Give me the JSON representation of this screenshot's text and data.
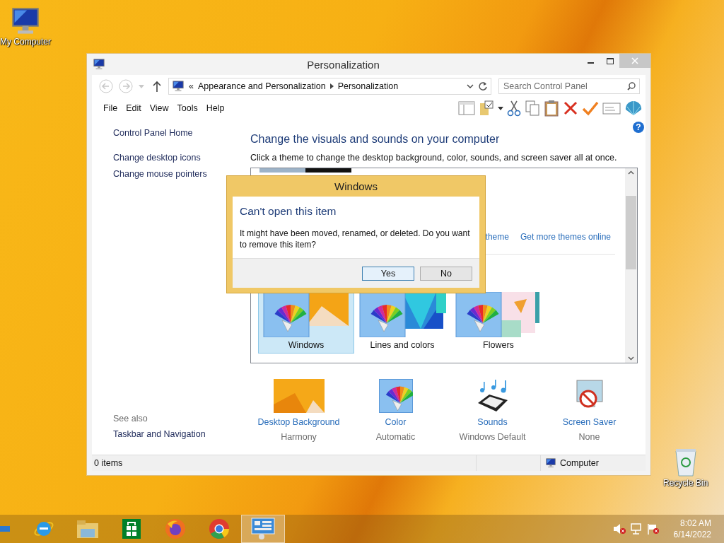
{
  "desktop_icons": [
    {
      "kind": "computer",
      "label": "My Computer"
    },
    {
      "kind": "recycle",
      "label": "Recycle Bin"
    }
  ],
  "window": {
    "title": "Personalization",
    "nav": [
      {
        "kind": "back",
        "disabled": true
      },
      {
        "kind": "forward",
        "disabled": true
      },
      {
        "kind": "recent",
        "disabled": true
      },
      {
        "kind": "up",
        "disabled": false
      }
    ],
    "address": {
      "overflow": "«",
      "crumbs": [
        "Appearance and Personalization",
        "Personalization"
      ]
    },
    "search": {
      "placeholder": "Search Control Panel"
    },
    "menu": [
      "File",
      "Edit",
      "View",
      "Tools",
      "Help"
    ],
    "help_button": "?",
    "sidebar": {
      "links": [
        "Control Panel Home",
        "Change desktop icons",
        "Change mouse pointers"
      ],
      "see_also_label": "See also",
      "see_also_links": [
        "Taskbar and Navigation"
      ]
    },
    "heading": "Change the visuals and sounds on your computer",
    "description": "Click a theme to change the desktop background, color, sounds, and screen saver all at once.",
    "theme_links": [
      "theme",
      "Get more themes online"
    ],
    "themes": [
      {
        "name": "Windows",
        "selected": true
      },
      {
        "name": "Lines and colors",
        "selected": false
      },
      {
        "name": "Flowers",
        "selected": false
      }
    ],
    "settings": [
      {
        "kind": "background",
        "label": "Desktop Background",
        "value": "Harmony"
      },
      {
        "kind": "color",
        "label": "Color",
        "value": "Automatic"
      },
      {
        "kind": "sounds",
        "label": "Sounds",
        "value": "Windows Default"
      },
      {
        "kind": "screensaver",
        "label": "Screen Saver",
        "value": "None"
      }
    ],
    "status_bar": {
      "items": "0 items",
      "location": "Computer"
    }
  },
  "dialog": {
    "title": "Windows",
    "heading": "Can't open this item",
    "message": "It might have been moved, renamed, or deleted. Do you want to remove this item?",
    "buttons": [
      {
        "label": "Yes",
        "default": true
      },
      {
        "label": "No",
        "default": false
      }
    ]
  },
  "taskbar": {
    "apps": [
      {
        "kind": "ie",
        "active": false
      },
      {
        "kind": "files",
        "active": false
      },
      {
        "kind": "store",
        "active": false
      },
      {
        "kind": "firefox",
        "active": false
      },
      {
        "kind": "chrome",
        "active": false
      },
      {
        "kind": "control",
        "active": true
      }
    ],
    "time": "8:02 AM",
    "date": "6/14/2022"
  }
}
